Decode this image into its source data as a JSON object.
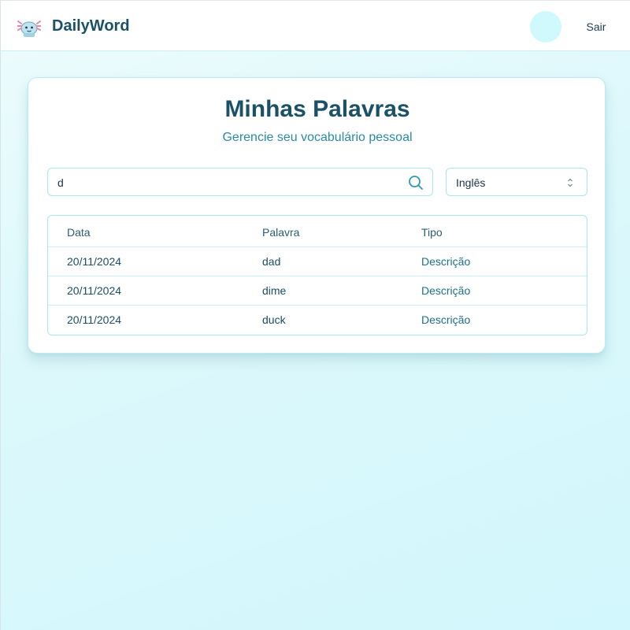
{
  "header": {
    "brand": "DailyWord",
    "logout_label": "Sair",
    "logo_icon": "axolotl-icon",
    "avatar": ""
  },
  "main": {
    "title": "Minhas Palavras",
    "subtitle": "Gerencie seu vocabulário pessoal",
    "search": {
      "value": "d",
      "placeholder": "",
      "icon": "search-icon"
    },
    "language_select": {
      "value": "Inglês",
      "icon": "chevron-up-down-icon"
    },
    "table": {
      "columns": [
        "Data",
        "Palavra",
        "Tipo"
      ],
      "rows": [
        [
          "20/11/2024",
          "dad",
          "Descrição"
        ],
        [
          "20/11/2024",
          "dime",
          "Descrição"
        ],
        [
          "20/11/2024",
          "duck",
          "Descrição"
        ]
      ]
    }
  },
  "colors": {
    "brand_text": "#1b5167",
    "accent": "#2a8ba3",
    "border": "#a8e7ee",
    "avatar_bg": "#cff9fc",
    "page_bg": "#d2f7fc"
  }
}
